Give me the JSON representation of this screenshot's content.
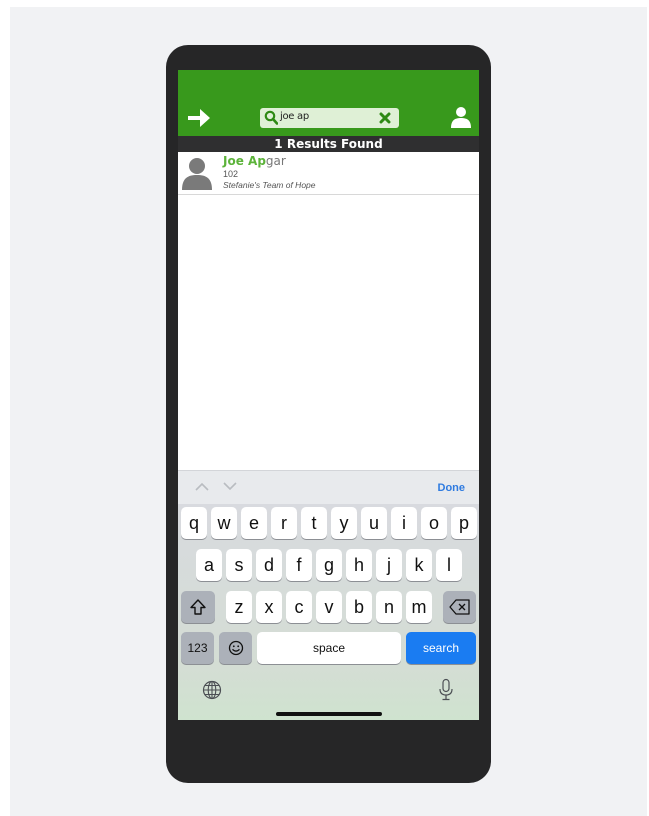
{
  "search": {
    "query": "joe ap"
  },
  "results": {
    "count_label": "1 Results Found"
  },
  "result_items": [
    {
      "name_match": "Joe Ap",
      "name_rest": "gar",
      "bib": "102",
      "team": "Stefanie's Team of Hope"
    }
  ],
  "keyboard": {
    "done_label": "Done",
    "row1": [
      "q",
      "w",
      "e",
      "r",
      "t",
      "y",
      "u",
      "i",
      "o",
      "p"
    ],
    "row2": [
      "a",
      "s",
      "d",
      "f",
      "g",
      "h",
      "j",
      "k",
      "l"
    ],
    "row3": [
      "z",
      "x",
      "c",
      "v",
      "b",
      "n",
      "m"
    ],
    "numbers_label": "123",
    "space_label": "space",
    "search_label": "search"
  },
  "icons": {
    "back": "arrow-right-icon",
    "search": "magnifier-icon",
    "clear": "x-icon",
    "profile": "user-icon",
    "avatar": "person-silhouette-icon",
    "shift": "shift-icon",
    "delete": "backspace-icon",
    "emoji": "emoji-icon",
    "globe": "globe-icon",
    "mic": "microphone-icon",
    "prev": "chevron-up-icon",
    "next": "chevron-down-icon"
  },
  "colors": {
    "header_green": "#38991c",
    "search_bg": "#dff0d6",
    "match_green": "#5cb33a",
    "results_bar": "#2f2f30",
    "ios_blue": "#1a7cf2"
  }
}
